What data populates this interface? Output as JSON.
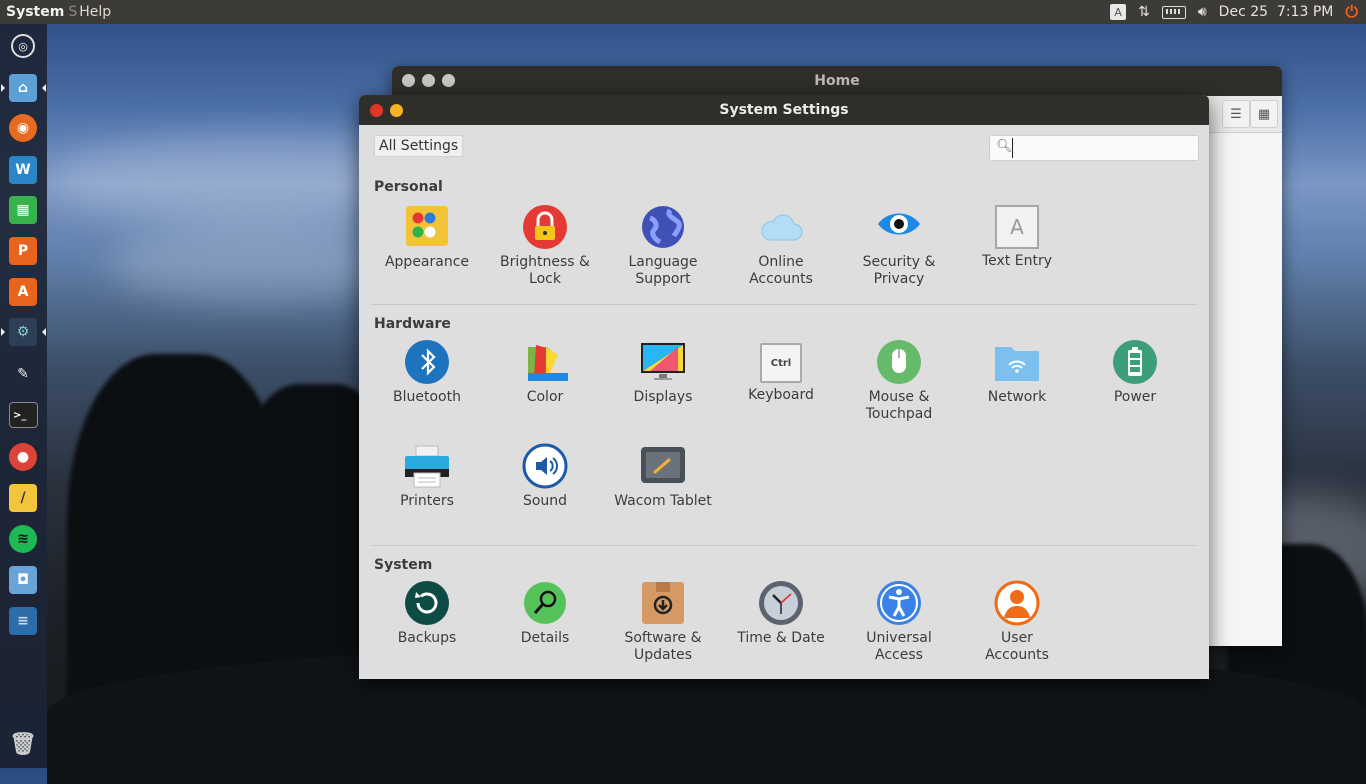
{
  "topbar": {
    "app_title": "System",
    "menu_fragment": "S",
    "menu_help": "Help",
    "keyboard_indicator": "A",
    "datetime": "Dec 25  7:13 PM"
  },
  "home_window": {
    "title": "Home"
  },
  "settings": {
    "title": "System Settings",
    "all_settings_label": "All Settings",
    "search": {
      "value": "",
      "placeholder": ""
    },
    "sections": {
      "personal": {
        "title": "Personal",
        "items": [
          {
            "label": "Appearance",
            "icon": "appearance-icon"
          },
          {
            "label": "Brightness & Lock",
            "icon": "lock-icon"
          },
          {
            "label": "Language Support",
            "icon": "globe-icon"
          },
          {
            "label": "Online Accounts",
            "icon": "cloud-icon"
          },
          {
            "label": "Security & Privacy",
            "icon": "eye-icon"
          },
          {
            "label": "Text Entry",
            "icon": "text-entry-icon"
          }
        ]
      },
      "hardware": {
        "title": "Hardware",
        "items": [
          {
            "label": "Bluetooth",
            "icon": "bluetooth-icon"
          },
          {
            "label": "Color",
            "icon": "color-icon"
          },
          {
            "label": "Displays",
            "icon": "display-icon"
          },
          {
            "label": "Keyboard",
            "icon": "keyboard-icon"
          },
          {
            "label": "Mouse & Touchpad",
            "icon": "mouse-icon"
          },
          {
            "label": "Network",
            "icon": "network-icon"
          },
          {
            "label": "Power",
            "icon": "battery-icon"
          },
          {
            "label": "Printers",
            "icon": "printer-icon"
          },
          {
            "label": "Sound",
            "icon": "sound-icon"
          },
          {
            "label": "Wacom Tablet",
            "icon": "tablet-icon"
          }
        ]
      },
      "system": {
        "title": "System",
        "items": [
          {
            "label": "Backups",
            "icon": "backup-icon"
          },
          {
            "label": "Details",
            "icon": "details-icon"
          },
          {
            "label": "Software & Updates",
            "icon": "software-icon"
          },
          {
            "label": "Time & Date",
            "icon": "clock-icon"
          },
          {
            "label": "Universal Access",
            "icon": "accessibility-icon"
          },
          {
            "label": "User Accounts",
            "icon": "user-icon"
          }
        ]
      }
    },
    "keyboard_icon_text": "Ctrl",
    "text_entry_icon_text": "A"
  },
  "colors": {
    "close_button": "#e0362a",
    "minimize_button": "#f5b325",
    "titlebar": "#2f2e2b",
    "accent_orange": "#f15d22"
  }
}
